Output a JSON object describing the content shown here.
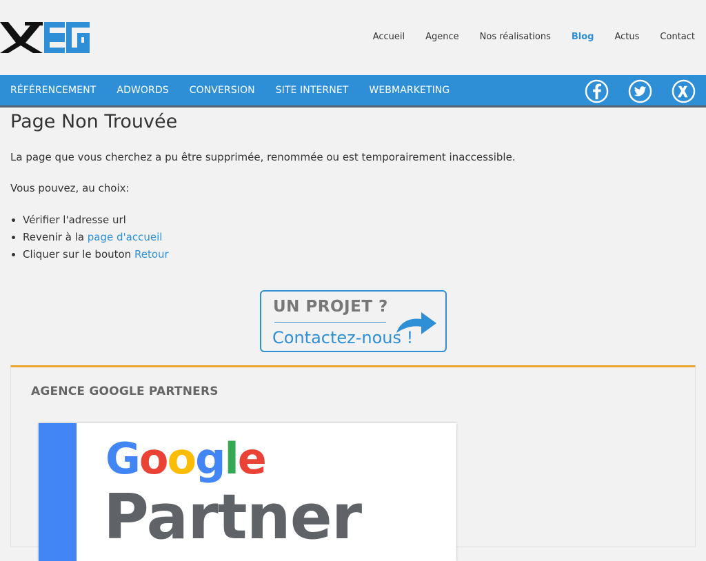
{
  "header": {
    "logo_alt": "XEEG",
    "nav": [
      {
        "label": "Accueil",
        "active": false
      },
      {
        "label": "Agence",
        "active": false
      },
      {
        "label": "Nos réalisations",
        "active": false
      },
      {
        "label": "Blog",
        "active": true
      },
      {
        "label": "Actus",
        "active": false
      },
      {
        "label": "Contact",
        "active": false
      }
    ]
  },
  "category_nav": [
    "RÉFÉRENCEMENT",
    "ADWORDS",
    "CONVERSION",
    "SITE INTERNET",
    "WEBMARKETING"
  ],
  "social": [
    "facebook-icon",
    "twitter-icon",
    "xing-icon"
  ],
  "main": {
    "title": "Page Non Trouvée",
    "intro": "La page que vous cherchez a pu être supprimée, renommée ou est temporairement inaccessible.",
    "choices_lead": "Vous pouvez, au choix:",
    "choices": [
      {
        "text": "Vérifier l'adresse url",
        "link": ""
      },
      {
        "text": "Revenir à la ",
        "link": "page d'accueil"
      },
      {
        "text": "Cliquer sur le bouton ",
        "link": "Retour"
      }
    ]
  },
  "cta": {
    "top": "UN PROJET ?",
    "bottom": "Contactez-nous !"
  },
  "partner": {
    "heading": "AGENCE GOOGLE PARTNERS",
    "badge_google": "Google",
    "badge_partner": "Partner"
  },
  "colors": {
    "accent": "#2e8fd6",
    "partner_border": "#e8a52a",
    "background": "#f2f2f2"
  }
}
